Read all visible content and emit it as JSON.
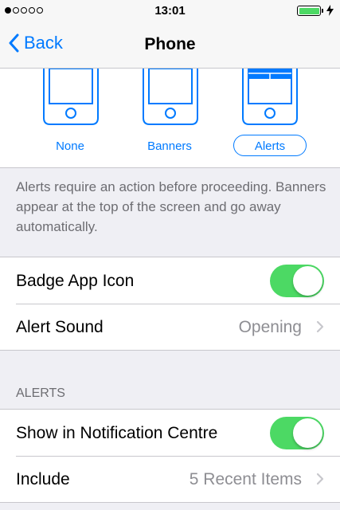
{
  "status_bar": {
    "time": "13:01",
    "signal_bars_filled": 1,
    "signal_bars_total": 5,
    "battery_level": 1.0,
    "battery_color": "#4cd964",
    "charging_icon": "bolt-icon"
  },
  "nav": {
    "back_label": "Back",
    "back_icon": "chevron-left-icon",
    "title": "Phone"
  },
  "alert_styles": {
    "options": [
      {
        "label": "None",
        "selected": false
      },
      {
        "label": "Banners",
        "selected": false
      },
      {
        "label": "Alerts",
        "selected": true
      }
    ],
    "description": "Alerts require an action before proceeding. Banners appear at the top of the screen and go away automatically."
  },
  "settings": {
    "badge_app_icon": {
      "label": "Badge App Icon",
      "value": true
    },
    "alert_sound": {
      "label": "Alert Sound",
      "value": "Opening"
    }
  },
  "alerts_section": {
    "header": "ALERTS",
    "show_in_notification_centre": {
      "label": "Show in Notification Centre",
      "value": true
    },
    "include": {
      "label": "Include",
      "value": "5 Recent Items"
    }
  },
  "colors": {
    "accent": "#007aff",
    "toggle_on": "#4cd964",
    "background": "#efeff4",
    "secondary_text": "#8e8e93"
  }
}
